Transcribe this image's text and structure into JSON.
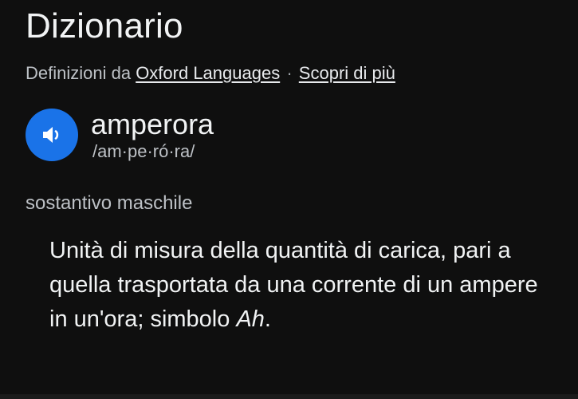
{
  "header": {
    "title": "Dizionario"
  },
  "source": {
    "prefix": "Definizioni da ",
    "provider_link": "Oxford Languages",
    "separator": "·",
    "more_link": "Scopri di più"
  },
  "entry": {
    "speaker_icon": "volume-icon",
    "word": "amperora",
    "pronunciation": "/am·pe·ró·ra/",
    "part_of_speech": "sostantivo maschile",
    "definition_text": "Unità di misura della quantità di carica, pari a quella trasportata da una corrente di un ampere in un'ora; simbolo ",
    "definition_symbol": "Ah",
    "definition_end": "."
  },
  "colors": {
    "background": "#0f0f0f",
    "accent": "#1a73e8",
    "primary_text": "#f1f3f4",
    "secondary_text": "#bdc1c6"
  }
}
